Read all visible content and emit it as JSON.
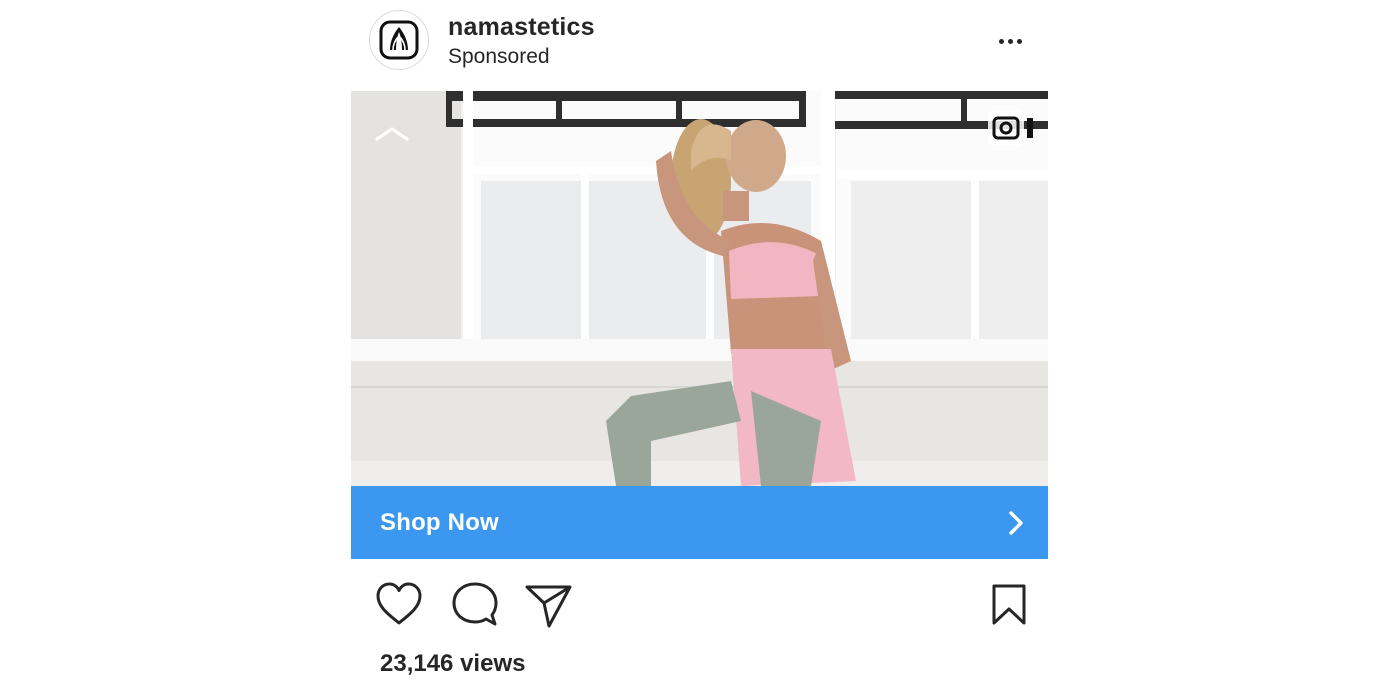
{
  "post": {
    "username": "namastetics",
    "sponsored_label": "Sponsored",
    "avatar_icon": "praying-hands-logo-icon",
    "more_icon": "more-options-icon",
    "media": {
      "collapse_icon": "chevron-up-icon",
      "video_badge_icon": "video-camera-icon"
    },
    "cta": {
      "label": "Shop Now",
      "icon": "chevron-right-icon",
      "color": "#3b97ef"
    },
    "actions": {
      "like_icon": "heart-icon",
      "comment_icon": "comment-icon",
      "share_icon": "paper-plane-icon",
      "save_icon": "bookmark-icon"
    },
    "views": "23,146 views"
  }
}
